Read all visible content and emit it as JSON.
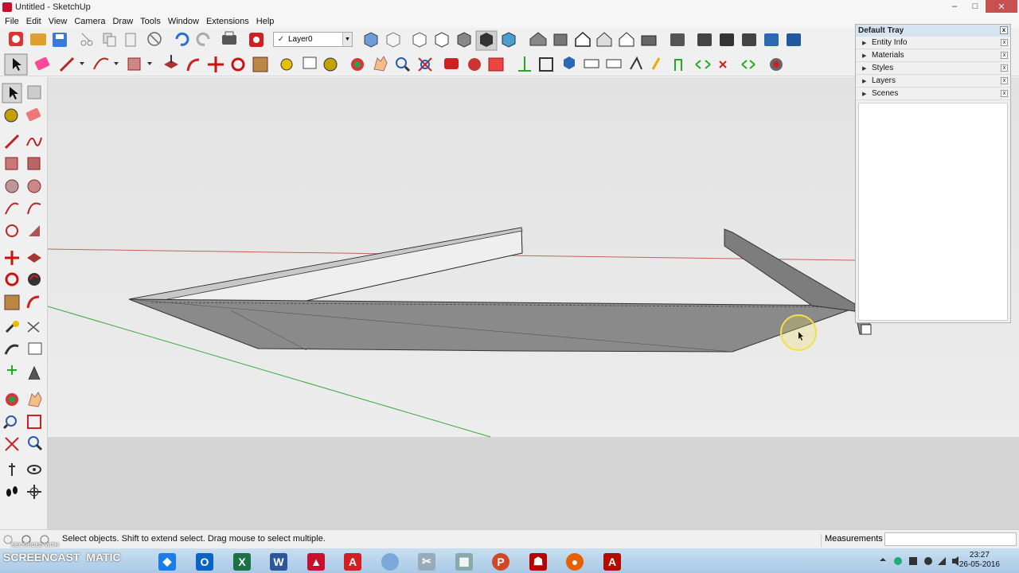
{
  "window": {
    "title": "Untitled - SketchUp",
    "minimize": "–",
    "maximize": "□",
    "close": "✕"
  },
  "menu": [
    "File",
    "Edit",
    "View",
    "Camera",
    "Draw",
    "Tools",
    "Window",
    "Extensions",
    "Help"
  ],
  "layer": {
    "check": "✓",
    "value": "Layer0",
    "arrow": "▼"
  },
  "tray": {
    "title": "Default Tray",
    "close": "x",
    "panels": [
      "Entity Info",
      "Materials",
      "Styles",
      "Layers",
      "Scenes"
    ],
    "expander": "▶",
    "panel_close": "x"
  },
  "status": {
    "hint": "Select objects. Shift to extend select. Drag mouse to select multiple.",
    "measurements_label": "Measurements",
    "measurements_value": ""
  },
  "taskbar": {
    "watermark": "SCREENCAST",
    "watermark_suffix": "MATIC",
    "recorded_with": "RECORDED WITH",
    "clock_time": "23:27",
    "clock_date": "26-05-2016"
  },
  "colors": {
    "accent": "#c8102e",
    "viewport_sky": "#e7e7e7",
    "viewport_ground": "#d4d4d4",
    "model_face": "#8a8a8a",
    "red_axis": "#c86060",
    "green_axis": "#3aa83a",
    "cursor_ring": "#f2e04a"
  }
}
